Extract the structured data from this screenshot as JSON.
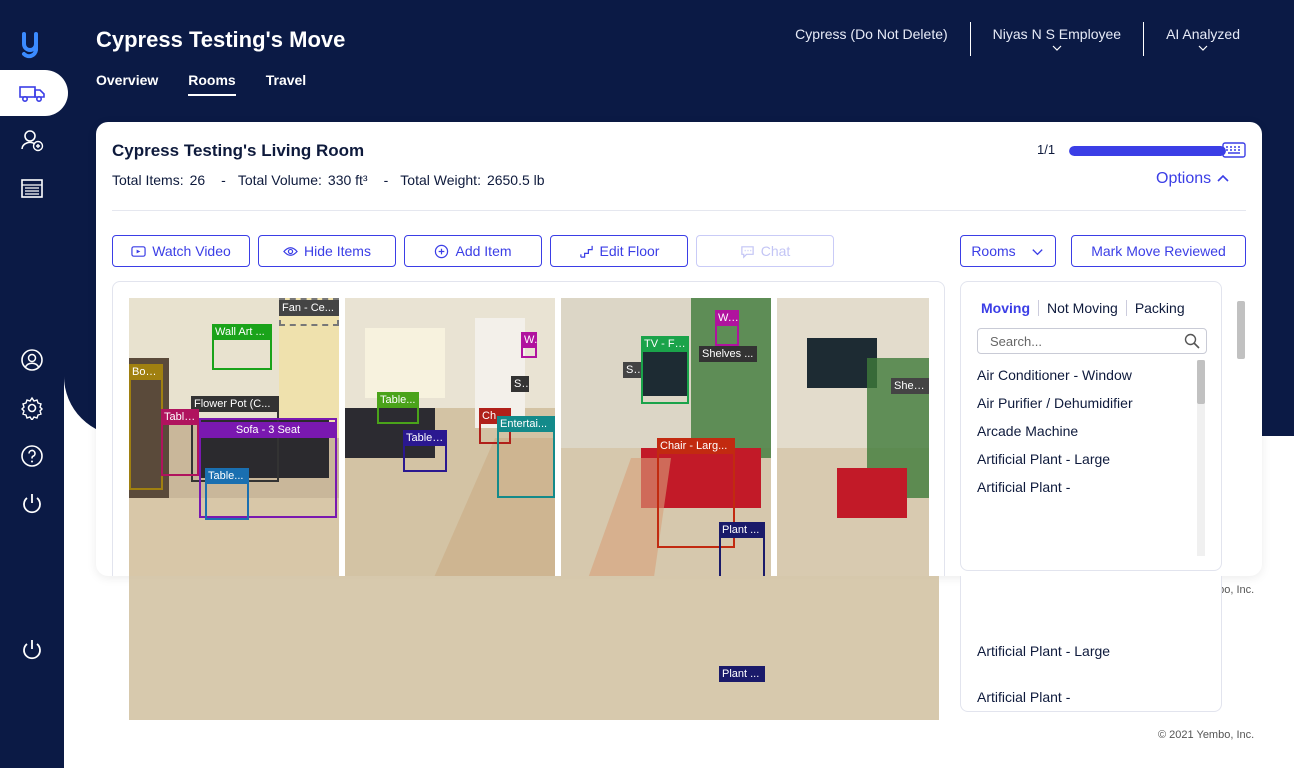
{
  "app": {
    "title": "Cypress Testing's Move",
    "tabs": [
      {
        "label": "Overview"
      },
      {
        "label": "Rooms"
      },
      {
        "label": "Travel"
      }
    ],
    "topbar": {
      "company": "Cypress (Do Not Delete)",
      "user": "Niyas N S Employee",
      "mode": "AI Analyzed"
    },
    "sidebar_icons": [
      "truck-icon",
      "add-user-icon",
      "calendar-icon",
      "account-icon",
      "settings-icon",
      "help-icon",
      "power-icon",
      "power-icon"
    ]
  },
  "room": {
    "title": "Cypress Testing's Living Room",
    "stats": {
      "items_label": "Total Items:",
      "items_value": "26",
      "volume_label": "Total Volume:",
      "volume_value": "330 ft³",
      "weight_label": "Total Weight:",
      "weight_value": "2650.5 lb",
      "separator": "-"
    },
    "pager": "1/1",
    "progress_fraction": 1.0,
    "options_label": "Options"
  },
  "toolbar": {
    "watch_video": "Watch Video",
    "hide_items": "Hide Items",
    "add_item": "Add Item",
    "edit_floor": "Edit Floor",
    "chat": "Chat",
    "rooms": "Rooms",
    "mark_reviewed": "Mark Move Reviewed"
  },
  "photos": [
    {
      "labels": [
        "Fan - Ce...",
        "Wall Art ...",
        "Boo...",
        "Flower Pot (C...",
        "Table...",
        "Sofa - 3 Seat",
        "Table..."
      ]
    },
    {
      "labels": [
        "W...",
        "S...",
        "Table...",
        "Table ...",
        "Ch...",
        "Entertai..."
      ]
    },
    {
      "labels": [
        "W...",
        "TV - Fl...",
        "S...",
        "Shelves ...",
        "Chair - Larg...",
        "Plant ..."
      ]
    },
    {
      "labels": [
        "Shelve..."
      ]
    }
  ],
  "item_panel": {
    "filters": [
      "Moving",
      "Not Moving",
      "Packing"
    ],
    "search_placeholder": "Search...",
    "items": [
      "Air Conditioner - Window",
      "Air Purifier / Dehumidifier",
      "Arcade Machine",
      "Artificial Plant - Large",
      "Artificial Plant -"
    ]
  },
  "ghost_labels": [
    "Artificial Plant - Large",
    "Artificial Plant -",
    "Plant ..."
  ],
  "footer": "© 2021 Yembo, Inc.",
  "colors": {
    "navy": "#0b1a45",
    "accent": "#3b3ee6"
  }
}
